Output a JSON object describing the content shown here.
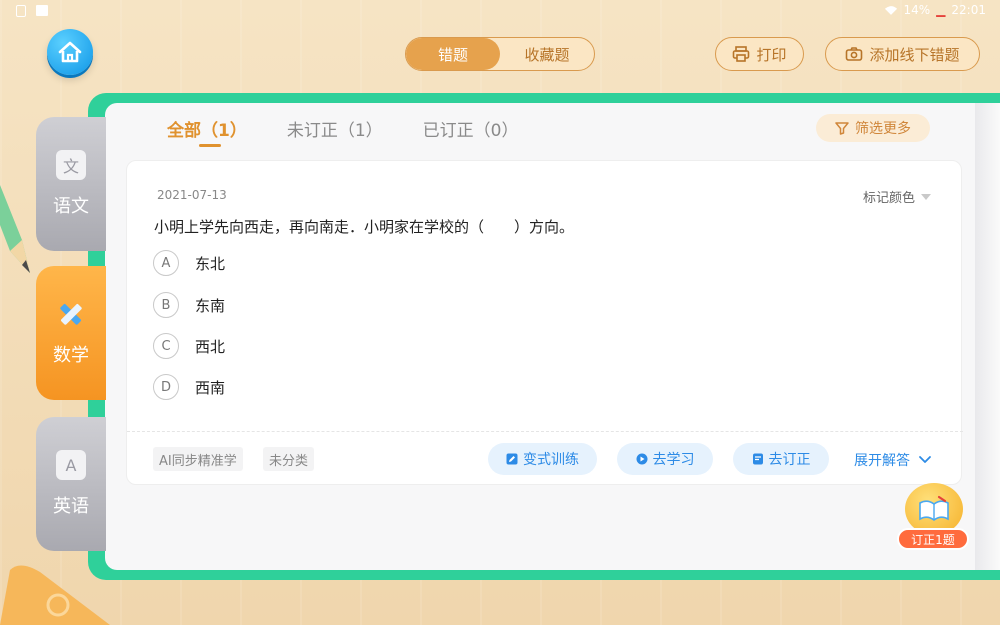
{
  "status_bar": {
    "battery_percent": "14%",
    "time": "22:01",
    "icons": [
      "sim-icon",
      "image-icon",
      "wifi-icon",
      "battery-icon"
    ]
  },
  "header": {
    "home_icon": "home-icon",
    "tabs": [
      {
        "label": "错题",
        "active": true
      },
      {
        "label": "收藏题",
        "active": false
      }
    ],
    "print_label": "打印",
    "print_icon": "printer-icon",
    "offline_label": "添加线下错题",
    "offline_icon": "camera-icon"
  },
  "subjects": [
    {
      "label": "语文",
      "icon": "book-wen-icon",
      "icon_text": "文",
      "active": false
    },
    {
      "label": "数学",
      "icon": "ruler-pencil-icon",
      "icon_text": "",
      "active": true
    },
    {
      "label": "英语",
      "icon": "book-a-icon",
      "icon_text": "A",
      "active": false
    }
  ],
  "filters": {
    "tabs": [
      {
        "label": "全部（1）",
        "active": true
      },
      {
        "label": "未订正（1）",
        "active": false
      },
      {
        "label": "已订正（0）",
        "active": false
      }
    ],
    "more_label": "筛选更多",
    "more_icon": "filter-icon"
  },
  "question": {
    "date": "2021-07-13",
    "mark_color_label": "标记颜色",
    "text": "小明上学先向西走，再向南走．小明家在学校的（　　）方向。",
    "options": [
      {
        "letter": "A",
        "text": "东北"
      },
      {
        "letter": "B",
        "text": "东南"
      },
      {
        "letter": "C",
        "text": "西北"
      },
      {
        "letter": "D",
        "text": "西南"
      }
    ],
    "tags": [
      "AI同步精准学",
      "未分类"
    ],
    "actions": {
      "variant": "变式训练",
      "learn": "去学习",
      "correct": "去订正",
      "expand": "展开解答"
    }
  },
  "badge": {
    "label": "订正1题",
    "icon": "open-book-icon"
  },
  "colors": {
    "accent_orange": "#e0922f",
    "frame_green": "#2fd09a",
    "link_blue": "#2d8be6",
    "home_blue": "#0f96e6"
  }
}
